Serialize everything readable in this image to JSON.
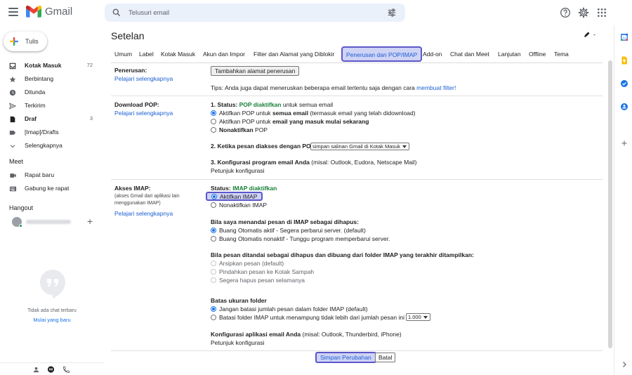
{
  "app": {
    "name": "Gmail"
  },
  "search": {
    "placeholder": "Telusuri email"
  },
  "compose": {
    "label": "Tulis"
  },
  "nav": {
    "items": [
      {
        "label": "Kotak Masuk",
        "count": "72",
        "bold": true,
        "icon": "inbox-icon"
      },
      {
        "label": "Berbintang",
        "count": "",
        "bold": false,
        "icon": "star-icon"
      },
      {
        "label": "Ditunda",
        "count": "",
        "bold": false,
        "icon": "clock-icon"
      },
      {
        "label": "Terkirim",
        "count": "",
        "bold": false,
        "icon": "send-icon"
      },
      {
        "label": "Draf",
        "count": "3",
        "bold": true,
        "icon": "draft-icon"
      },
      {
        "label": "[Imap]/Drafts",
        "count": "",
        "bold": false,
        "icon": "label-icon"
      },
      {
        "label": "Selengkapnya",
        "count": "",
        "bold": false,
        "icon": "chevron-down-icon"
      }
    ]
  },
  "meet": {
    "title": "Meet",
    "new_meeting": "Rapat baru",
    "join_meeting": "Gabung ke rapat"
  },
  "hangout": {
    "title": "Hangout",
    "no_chat": "Tidak ada chat terbaru",
    "start_new": "Mulai yang baru"
  },
  "settings": {
    "title": "Setelan",
    "tabs": [
      "Umum",
      "Label",
      "Kotak Masuk",
      "Akun dan Impor",
      "Filter dan Alamat yang Diblokir",
      "Penerusan dan POP/IMAP",
      "Add-on",
      "Chat dan Meet",
      "Lanjutan",
      "Offline",
      "Tema"
    ],
    "active_tab": "Penerusan dan POP/IMAP",
    "forwarding": {
      "label": "Penerusan:",
      "learn_more": "Pelajari selengkapnya",
      "add_button": "Tambahkan alamat penerusan",
      "tip_prefix": "Tips: Anda juga dapat meneruskan beberapa email tertentu saja dengan cara",
      "tip_link": "membuat filter!"
    },
    "pop": {
      "label": "Download POP:",
      "learn_more": "Pelajari selengkapnya",
      "status_prefix": "1. Status:",
      "status_value": "POP diaktifkan",
      "status_suffix": "untuk semua email",
      "options": [
        {
          "prefix": "Aktifkan POP untuk",
          "bold": "semua email",
          "suffix": "(termasuk email yang telah didownload)",
          "checked": true
        },
        {
          "prefix": "Aktifkan POP untuk",
          "bold": "email yang masuk mulai sekarang",
          "suffix": "",
          "checked": false
        },
        {
          "prefix": "",
          "bold": "Nonaktifkan",
          "suffix": "POP",
          "checked": false
        }
      ],
      "step2_label": "2. Ketika pesan diakses dengan POP",
      "step2_select": "simpan salinan Gmail di Kotak Masuk",
      "step3_label": "3. Konfigurasi program email Anda",
      "step3_note": "(misal: Outlook, Eudora, Netscape Mail)",
      "config_link": "Petunjuk konfigurasi"
    },
    "imap": {
      "label": "Akses IMAP:",
      "sub": "(akses Gmail dari aplikasi lain menggunakan IMAP)",
      "learn_more": "Pelajari selengkapnya",
      "status_prefix": "Status:",
      "status_value": "IMAP diaktifkan",
      "enable": "Aktifkan IMAP",
      "disable": "Nonaktifkan IMAP",
      "deleted_title": "Bila saya menandai pesan di IMAP sebagai dihapus:",
      "deleted_options": [
        {
          "label": "Buang Otomatis aktif - Segera perbarui server. (default)",
          "checked": true
        },
        {
          "label": "Buang Otomatis nonaktif - Tunggu program memperbarui server.",
          "checked": false
        }
      ],
      "expunged_title": "Bila pesan ditandai sebagai dihapus dan dibuang dari folder IMAP yang terakhir ditampilkan:",
      "expunged_options": [
        "Arsipkan pesan (default)",
        "Pindahkan pesan ke Kotak Sampah",
        "Segera hapus pesan selamanya"
      ],
      "folder_title": "Batas ukuran folder",
      "folder_options": [
        {
          "label": "Jangan batasi jumlah pesan dalam folder IMAP (default)",
          "checked": true
        },
        {
          "label": "Batasi folder IMAP untuk menampung tidak lebih dari jumlah pesan ini",
          "checked": false
        }
      ],
      "folder_limit": "1.000",
      "config_title": "Konfigurasi aplikasi email Anda",
      "config_note": "(misal: Outlook, Thunderbird, iPhone)",
      "config_link": "Petunjuk konfigurasi"
    },
    "save_button": "Simpan Perubahan",
    "cancel_button": "Batal"
  },
  "colors": {
    "accent": "#1a73e8",
    "highlight_border": "#5b57c8",
    "highlight_fill": "#cfd3f5",
    "status_green": "#188038"
  }
}
